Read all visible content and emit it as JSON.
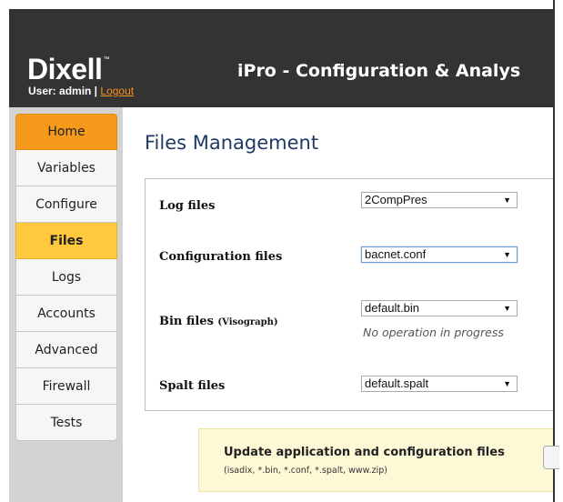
{
  "header": {
    "brand": "Dixell",
    "brand_mark": "™",
    "user_label": "User: admin |",
    "logout_label": "Logout",
    "app_title": "iPro - Configuration & Analys"
  },
  "sidebar": {
    "items": [
      {
        "label": "Home"
      },
      {
        "label": "Variables"
      },
      {
        "label": "Configure"
      },
      {
        "label": "Files"
      },
      {
        "label": "Logs"
      },
      {
        "label": "Accounts"
      },
      {
        "label": "Advanced"
      },
      {
        "label": "Firewall"
      },
      {
        "label": "Tests"
      }
    ],
    "active": "Files"
  },
  "main": {
    "title": "Files Management",
    "rows": [
      {
        "label": "Log files",
        "selected": "2CompPres"
      },
      {
        "label": "Configuration files",
        "selected": "bacnet.conf"
      },
      {
        "label": "Bin files",
        "label_suffix": "(Visograph)",
        "selected": "default.bin",
        "status": "No operation in progress"
      },
      {
        "label": "Spalt files",
        "selected": "default.spalt"
      }
    ],
    "update": {
      "title": "Update application and configuration files",
      "subtitle": "(isadix, *.bin, *.conf, *.spalt, www.zip)"
    }
  },
  "colors": {
    "header_bg": "#333333",
    "home_tab": "#f59a1b",
    "active_tab": "#ffc83d",
    "logout_link": "#f7941d",
    "title_text": "#1f3a63",
    "update_bg": "#fdf9d7"
  }
}
